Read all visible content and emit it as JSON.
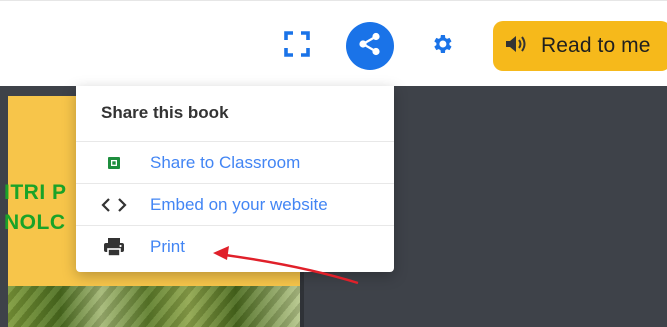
{
  "toolbar": {
    "fullscreen_icon": "fullscreen-icon",
    "share_icon": "share-icon",
    "settings_icon": "gear-icon",
    "read_button": {
      "icon": "speaker-icon",
      "label": "Read to me"
    }
  },
  "book_page": {
    "title_lines": [
      "ITRI P",
      "NOLC"
    ]
  },
  "share_menu": {
    "title": "Share this book",
    "items": [
      {
        "icon": "classroom-icon",
        "label": "Share to Classroom"
      },
      {
        "icon": "code-icon",
        "label": "Embed on your website"
      },
      {
        "icon": "printer-icon",
        "label": "Print"
      }
    ]
  },
  "colors": {
    "share_button": "#1a73e8",
    "read_button": "#f6b91b",
    "menu_link": "#4285f4",
    "annotation_arrow": "#e0202a",
    "book_title": "#1aa328",
    "page_background": "#f7c54a",
    "viewer_background": "#3e4249"
  }
}
